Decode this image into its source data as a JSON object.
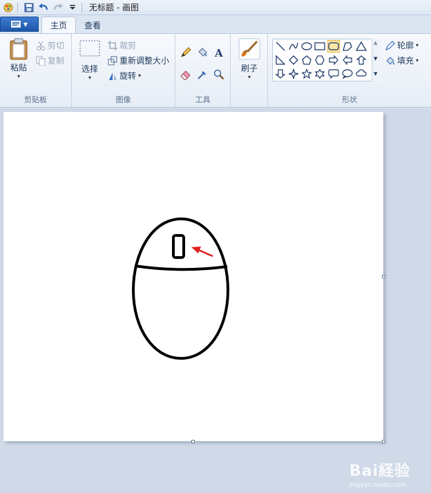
{
  "window": {
    "title": "无标题 - 画图"
  },
  "tabs": [
    {
      "label": "主页"
    },
    {
      "label": "查看"
    }
  ],
  "groups": {
    "clipboard": {
      "label": "剪贴板",
      "paste": "粘贴",
      "cut": "剪切",
      "copy": "复制"
    },
    "image": {
      "label": "图像",
      "select": "选择",
      "crop": "裁剪",
      "resize": "重新调整大小",
      "rotate": "旋转"
    },
    "tools": {
      "label": "工具"
    },
    "brushes": {
      "label": "刷子"
    },
    "shapes": {
      "label": "形状",
      "outline": "轮廓",
      "fill": "填充"
    }
  },
  "watermark": {
    "brand": "Bai経验",
    "site": "jingyan.baidu.com"
  },
  "colors": {
    "accent_blue": "#1c56a8",
    "arrow_red": "#e02020",
    "selected_shape": "#fde6a8"
  }
}
